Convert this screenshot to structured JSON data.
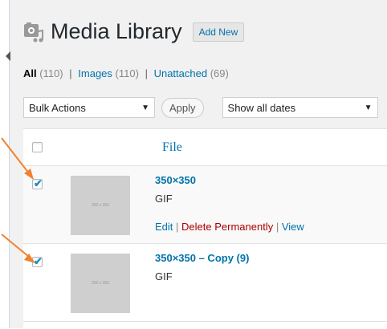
{
  "header": {
    "title": "Media Library",
    "add_new": "Add New"
  },
  "filters": {
    "all_label": "All",
    "all_count": "(110)",
    "images_label": "Images",
    "images_count": "(110)",
    "unattached_label": "Unattached",
    "unattached_count": "(69)",
    "separator": "|"
  },
  "controls": {
    "bulk_actions": "Bulk Actions",
    "apply": "Apply",
    "dates": "Show all dates"
  },
  "table": {
    "file_header": "File",
    "rows": [
      {
        "title": "350×350",
        "type": "GIF",
        "thumb_text": "350 x 350",
        "checked": true,
        "actions": {
          "edit": "Edit",
          "delete": "Delete Permanently",
          "view": "View",
          "sep": "|"
        }
      },
      {
        "title": "350×350 – Copy (9)",
        "type": "GIF",
        "thumb_text": "350 x 350",
        "checked": true
      }
    ]
  },
  "colors": {
    "accent": "#0073aa",
    "delete": "#aa0000",
    "arrow": "#f0822d"
  },
  "icons": [
    "media-library-icon",
    "checkbox-icon",
    "caret-down-icon",
    "arrow-annotation"
  ]
}
